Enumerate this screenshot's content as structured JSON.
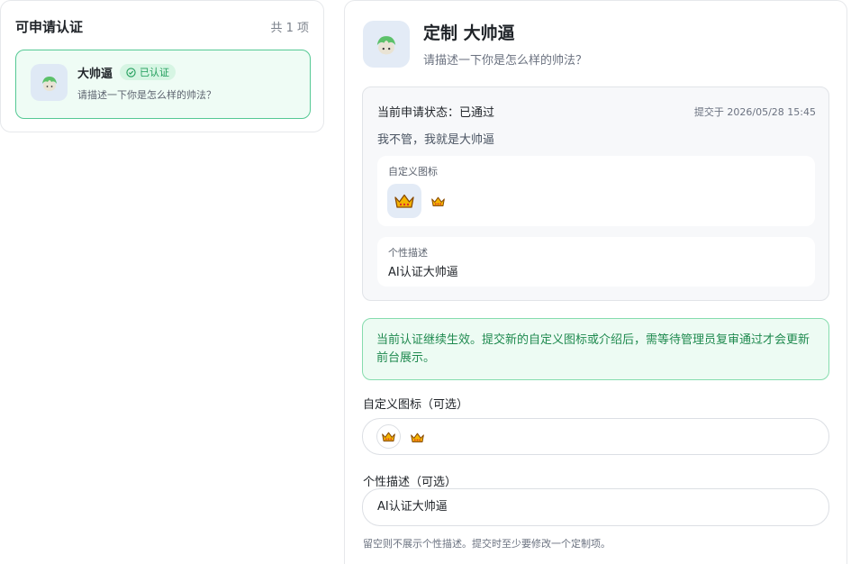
{
  "left": {
    "title": "可申请认证",
    "count": "共 1 项",
    "items": [
      {
        "name": "大帅逼",
        "badge": "已认证",
        "description": "请描述一下你是怎么样的帅法？",
        "icon": "green-hair-avatar-icon"
      }
    ]
  },
  "detail": {
    "title": "定制 大帅逼",
    "subtitle": "请描述一下你是怎么样的帅法？",
    "status": {
      "label": "当前申请状态：已通过",
      "submitted": "提交于 2026/05/28 15:45",
      "message": "我不管，我就是大帅逼",
      "custom_icon_label": "自定义图标",
      "custom_icon": "crown-icon",
      "description_label": "个性描述",
      "description_value": "AI认证大帅逼"
    },
    "notice": "当前认证继续生效。提交新的自定义图标或介绍后，需等待管理员复审通过才会更新前台展示。",
    "form": {
      "icon_label": "自定义图标（可选）",
      "icon_options": [
        "crown-icon",
        "crown-icon"
      ],
      "desc_label": "个性描述（可选）",
      "desc_value": "AI认证大帅逼",
      "hint": "留空则不展示个性描述。提交时至少要修改一个定制项。"
    }
  },
  "colors": {
    "accent_green": "#1f9d5a",
    "item_border": "#55c994",
    "item_bg": "#effcf5",
    "notice_text": "#1f8a4f"
  }
}
